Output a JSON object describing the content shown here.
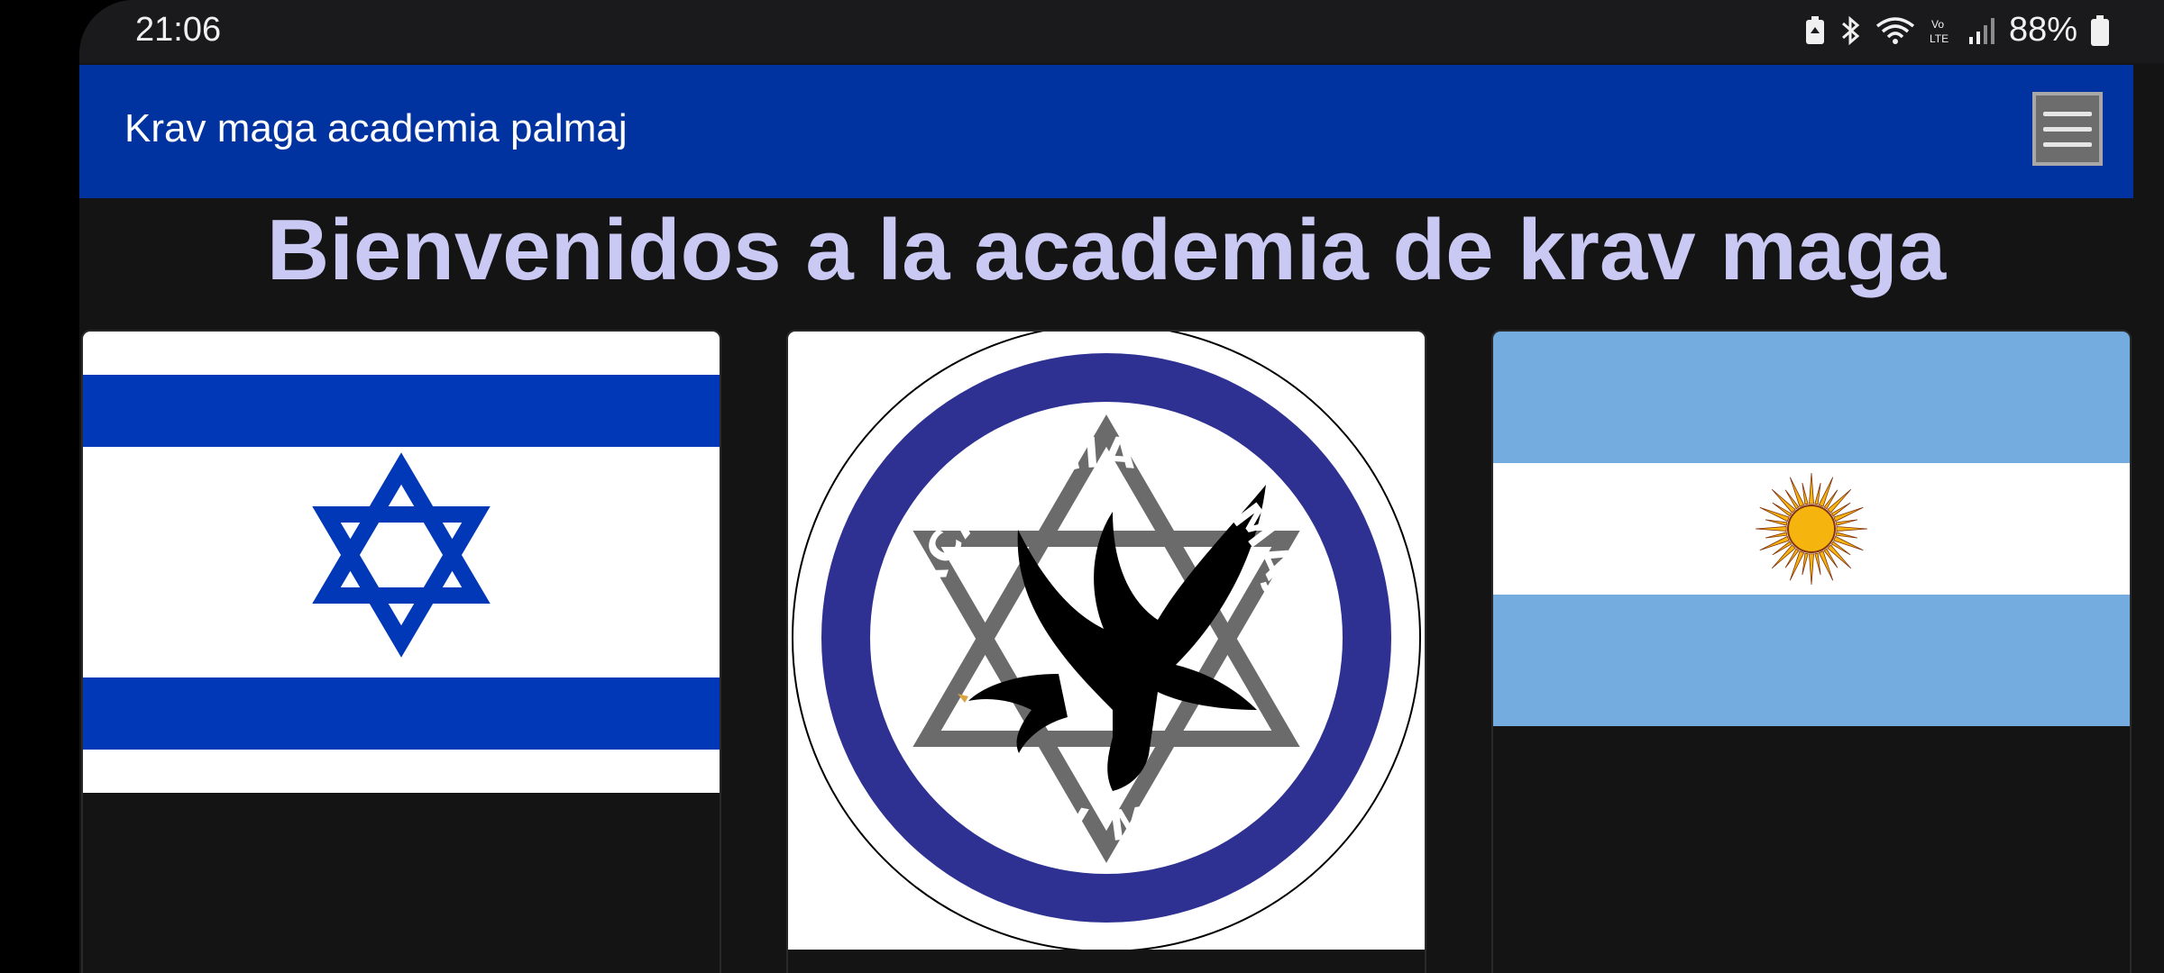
{
  "status_bar": {
    "time": "21:06",
    "battery_percent": "88%",
    "icons": [
      "battery-saver-icon",
      "bluetooth-icon",
      "wifi-icon",
      "volte-icon",
      "signal-icon",
      "battery-icon"
    ]
  },
  "app_bar": {
    "title": "Krav maga academia palmaj",
    "menu_icon": "hamburger-menu-icon",
    "background_color": "#0033a0"
  },
  "main": {
    "heading": "Bienvenidos a la academia de krav maga",
    "heading_color": "#c9c9f4",
    "cards": [
      {
        "image": "israel-flag"
      },
      {
        "image": "academia-palmaj-logo",
        "logo_top_text": "ACADEMIA PALMAJ",
        "logo_bottom_text": "KRAV MAGA"
      },
      {
        "image": "argentina-flag"
      }
    ]
  },
  "colors": {
    "israel_blue": "#0038b8",
    "argentina_light_blue": "#74acdf",
    "sun_gold": "#f6b40e",
    "logo_ring_blue": "#2e3192",
    "star_gray": "#6b6b6b"
  }
}
